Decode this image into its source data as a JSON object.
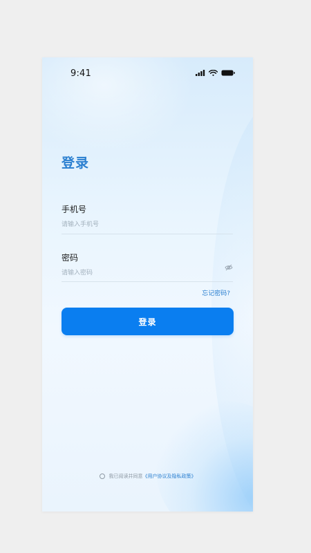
{
  "status_bar": {
    "time": "9:41",
    "icons": [
      "signal-icon",
      "wifi-icon",
      "battery-icon"
    ]
  },
  "login": {
    "title": "登录",
    "phone_label": "手机号",
    "phone_placeholder": "请输入手机号",
    "phone_value": "",
    "password_label": "密码",
    "password_placeholder": "请输入密码",
    "password_value": "",
    "password_toggle_icon": "eye-off-icon",
    "forgot_link": "忘记密码?",
    "submit_label": "登录"
  },
  "agreement": {
    "checked": false,
    "text": "我已阅读并同意",
    "link": "《用户协议及隐私政策》"
  },
  "colors": {
    "accent": "#2a7fd0",
    "button": "#0a7ef0",
    "page_background": "#efefef"
  }
}
